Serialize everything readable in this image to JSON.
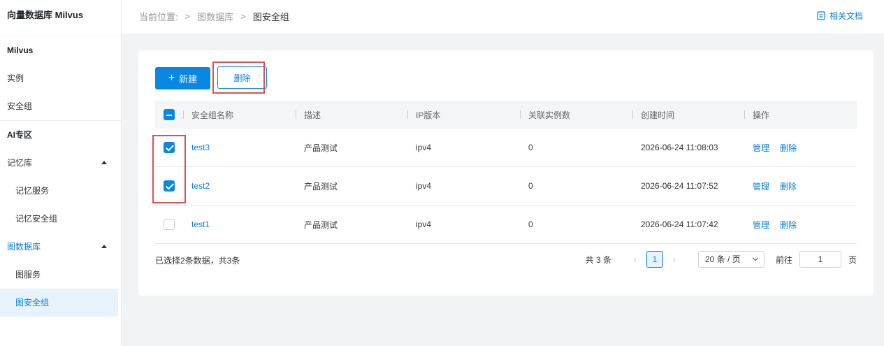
{
  "sidebar": {
    "brand": "向量数据库 Milvus",
    "sections": {
      "milvus": "Milvus",
      "instance": "实例",
      "security_group": "安全组",
      "ai_zone": "AI专区",
      "memory": "记忆库",
      "memory_service": "记忆服务",
      "memory_security_group": "记忆安全组",
      "graph_db": "图数据库",
      "graph_service": "图服务",
      "graph_security_group": "图安全组"
    }
  },
  "header": {
    "breadcrumb_prefix": "当前位置:",
    "breadcrumb_parent": "图数据库",
    "breadcrumb_current": "图安全组",
    "doc_link": "相关文档"
  },
  "toolbar": {
    "new_label": "新建",
    "delete_label": "删除"
  },
  "table": {
    "headers": [
      "安全组名称",
      "描述",
      "IP版本",
      "关联实例数",
      "创建时间",
      "操作"
    ],
    "rows": [
      {
        "name": "test3",
        "desc": "产品测试",
        "ip": "ipv4",
        "count": "0",
        "created": "2026-06-24 11:08:03",
        "manage": "管理",
        "delete": "删除",
        "checked": true
      },
      {
        "name": "test2",
        "desc": "产品测试",
        "ip": "ipv4",
        "count": "0",
        "created": "2026-06-24 11:07:52",
        "manage": "管理",
        "delete": "删除",
        "checked": true
      },
      {
        "name": "test1",
        "desc": "产品测试",
        "ip": "ipv4",
        "count": "0",
        "created": "2026-06-24 11:07:42",
        "manage": "管理",
        "delete": "删除",
        "checked": false
      }
    ]
  },
  "footer": {
    "selection_info": "已选择2条数据，共3条",
    "total": "共 3 条",
    "current_page": "1",
    "page_size": "20 条 / 页",
    "goto_label": "前往",
    "goto_value": "1",
    "page_suffix": "页"
  },
  "colors": {
    "accent": "#0a86e3",
    "highlight": "#d9534f"
  }
}
